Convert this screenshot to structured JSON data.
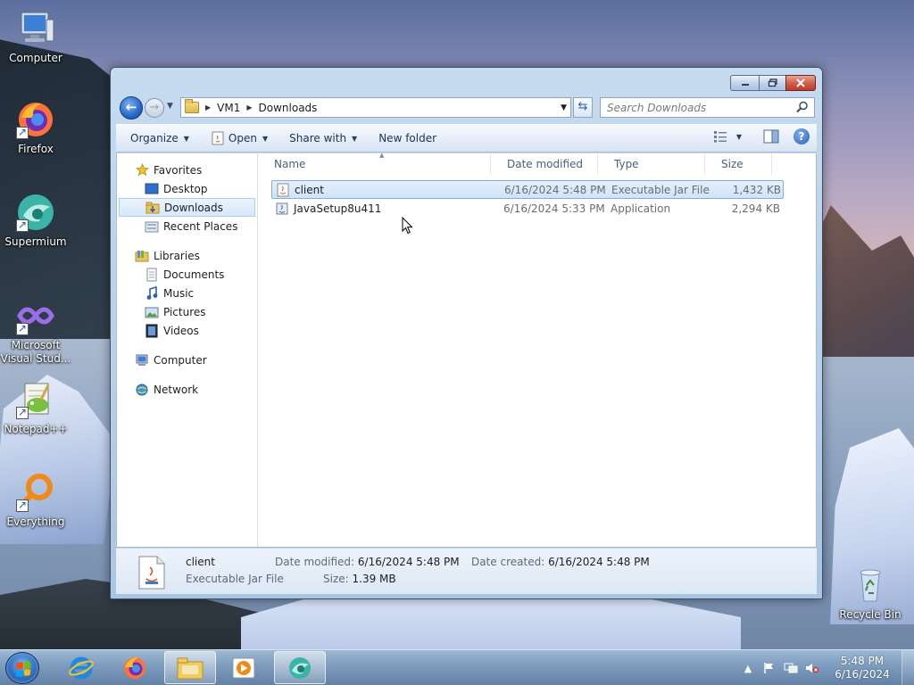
{
  "desktop": {
    "icons": [
      {
        "label": "Computer"
      },
      {
        "label": "Firefox"
      },
      {
        "label": "Supermium"
      },
      {
        "label": "Microsoft Visual Stud..."
      },
      {
        "label": "Notepad++"
      },
      {
        "label": "Everything"
      },
      {
        "label": "Recycle Bin"
      }
    ]
  },
  "window": {
    "breadcrumb": [
      "VM1",
      "Downloads"
    ],
    "search_placeholder": "Search Downloads",
    "toolbar": {
      "organize": "Organize",
      "open": "Open",
      "share_with": "Share with",
      "new_folder": "New folder"
    },
    "nav": {
      "favorites": "Favorites",
      "favorites_items": [
        "Desktop",
        "Downloads",
        "Recent Places"
      ],
      "libraries": "Libraries",
      "libraries_items": [
        "Documents",
        "Music",
        "Pictures",
        "Videos"
      ],
      "computer": "Computer",
      "network": "Network"
    },
    "columns": {
      "name": "Name",
      "date": "Date modified",
      "type": "Type",
      "size": "Size"
    },
    "files": [
      {
        "name": "client",
        "date": "6/16/2024 5:48 PM",
        "type": "Executable Jar File",
        "size": "1,432 KB",
        "selected": true
      },
      {
        "name": "JavaSetup8u411",
        "date": "6/16/2024 5:33 PM",
        "type": "Application",
        "size": "2,294 KB",
        "selected": false
      }
    ],
    "details": {
      "name": "client",
      "type": "Executable Jar File",
      "date_modified_label": "Date modified:",
      "date_modified": "6/16/2024 5:48 PM",
      "size_label": "Size:",
      "size": "1.39 MB",
      "date_created_label": "Date created:",
      "date_created": "6/16/2024 5:48 PM"
    }
  },
  "taskbar": {
    "clock_time": "5:48 PM",
    "clock_date": "6/16/2024"
  },
  "colors": {
    "selection": "#cfe3f9",
    "accent": "#2a62b8"
  }
}
